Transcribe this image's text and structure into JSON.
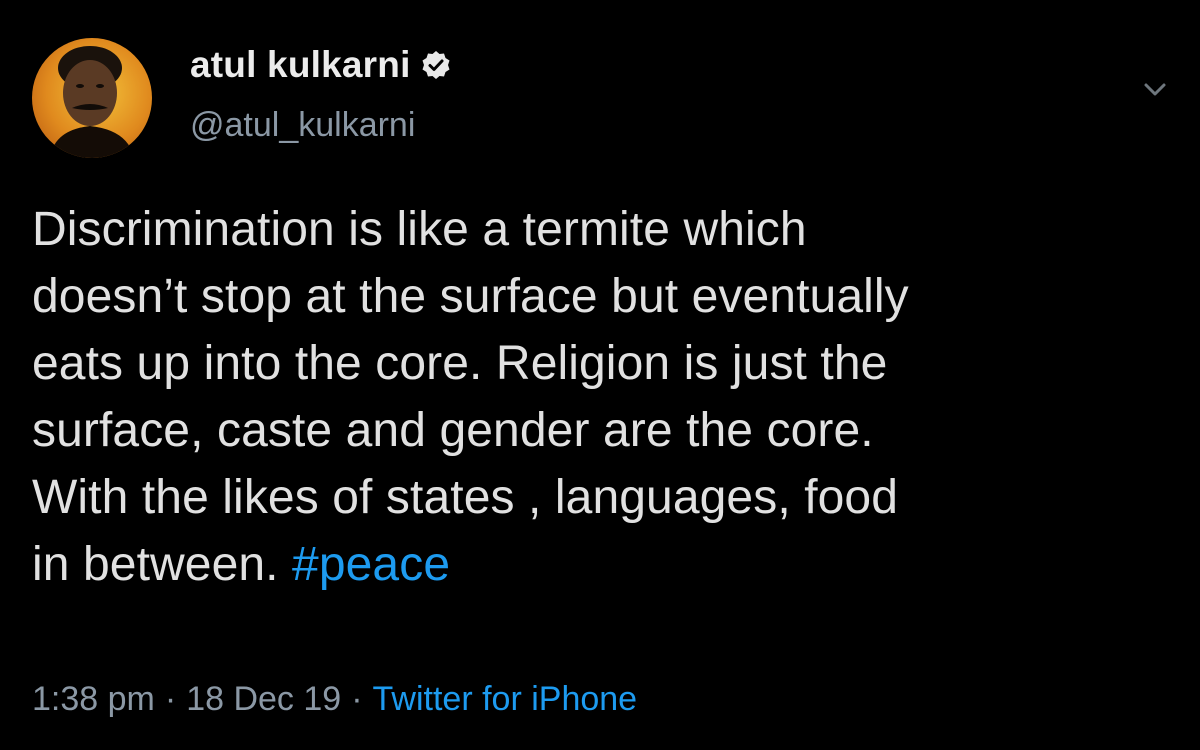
{
  "user": {
    "display_name": "atul kulkarni",
    "handle": "@atul_kulkarni",
    "verified_icon": "verified-badge-icon",
    "avatar_icon": "profile-photo"
  },
  "menu": {
    "icon": "chevron-down-icon"
  },
  "tweet": {
    "lines": [
      "Discrimination is like a termite which",
      "doesn’t stop at the surface but eventually",
      "eats up into the core. Religion is just the",
      "surface, caste and gender are the core.",
      "With the likes of states , languages, food",
      "in between. "
    ],
    "hashtag": "#peace"
  },
  "meta": {
    "time": "1:38 pm",
    "separator": "·",
    "date": "18 Dec 19",
    "source": "Twitter for iPhone"
  },
  "colors": {
    "background": "#000000",
    "text": "#e1e1e1",
    "secondary": "#8b98a5",
    "link": "#1d9bf0"
  }
}
